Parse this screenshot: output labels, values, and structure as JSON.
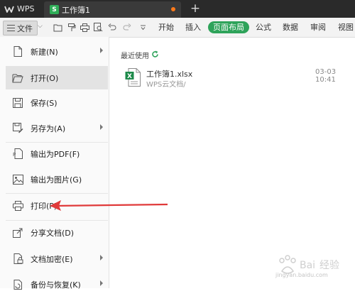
{
  "app": {
    "wps_tab_label": "WPS",
    "doc_tab_label": "工作簿1",
    "doc_icon_letter": "S",
    "new_tab_symbol": "+",
    "unsaved_dot_color": "#ff7a1a"
  },
  "toolbar": {
    "file_label": "文件",
    "menu_items": [
      "开始",
      "插入",
      "页面布局",
      "公式",
      "数据",
      "审阅",
      "视图"
    ],
    "active_menu": "页面布局",
    "quick_access_icons": [
      "open-folder-icon",
      "format-painter-icon",
      "print-icon",
      "print-preview-icon",
      "undo-icon",
      "redo-icon",
      "customize-icon"
    ]
  },
  "file_menu": {
    "items": [
      {
        "label": "新建(N)",
        "icon": "new-doc-icon",
        "has_submenu": true
      },
      {
        "label": "打开(O)",
        "icon": "folder-open-icon",
        "has_submenu": false,
        "selected": true
      },
      {
        "label": "保存(S)",
        "icon": "save-icon",
        "has_submenu": false
      },
      {
        "label": "另存为(A)",
        "icon": "save-as-icon",
        "has_submenu": true
      },
      {
        "label": "输出为PDF(F)",
        "icon": "pdf-icon",
        "has_submenu": false
      },
      {
        "label": "输出为图片(G)",
        "icon": "image-icon",
        "has_submenu": false
      },
      {
        "label": "打印(P)",
        "icon": "print-icon",
        "has_submenu": true
      },
      {
        "label": "分享文档(D)",
        "icon": "share-icon",
        "has_submenu": false
      },
      {
        "label": "文档加密(E)",
        "icon": "encrypt-icon",
        "has_submenu": true
      },
      {
        "label": "备份与恢复(K)",
        "icon": "backup-icon",
        "has_submenu": true
      }
    ]
  },
  "recent": {
    "title": "最近使用",
    "files": [
      {
        "name": "工作簿1.xlsx",
        "path": "WPS云文档/",
        "date": "03-03 10:41"
      }
    ]
  },
  "watermark": {
    "text": "jingyan.baidu.com"
  },
  "colors": {
    "accent_green": "#2ea35a",
    "annotation_red": "#e03a3a"
  }
}
